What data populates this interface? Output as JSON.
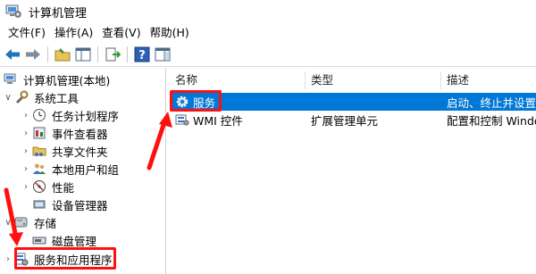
{
  "window": {
    "title": "计算机管理"
  },
  "menu": [
    "文件(F)",
    "操作(A)",
    "查看(V)",
    "帮助(H)"
  ],
  "toolbar": {
    "icons": [
      "back-arrow-icon",
      "forward-arrow-icon",
      "up-folder-icon",
      "show-hide-tree-icon",
      "export-list-icon",
      "help-icon",
      "action-pane-icon"
    ]
  },
  "tree": {
    "root": "计算机管理(本地)",
    "system_tools": "系统工具",
    "task_scheduler": "任务计划程序",
    "event_viewer": "事件查看器",
    "shared_folders": "共享文件夹",
    "local_users": "本地用户和组",
    "performance": "性能",
    "device_manager": "设备管理器",
    "storage": "存储",
    "disk_management": "磁盘管理",
    "services_apps": "服务和应用程序"
  },
  "list": {
    "columns": {
      "name": "名称",
      "type": "类型",
      "desc": "描述"
    },
    "rows": [
      {
        "name": "服务",
        "type": "",
        "desc": "启动、终止并设置"
      },
      {
        "name": "WMI 控件",
        "type": "扩展管理单元",
        "desc": "配置和控制 Windo"
      }
    ]
  },
  "colors": {
    "selection": "#0078d7",
    "annotation": "#ff1010",
    "toolbar_arrow": "#1e73be"
  }
}
